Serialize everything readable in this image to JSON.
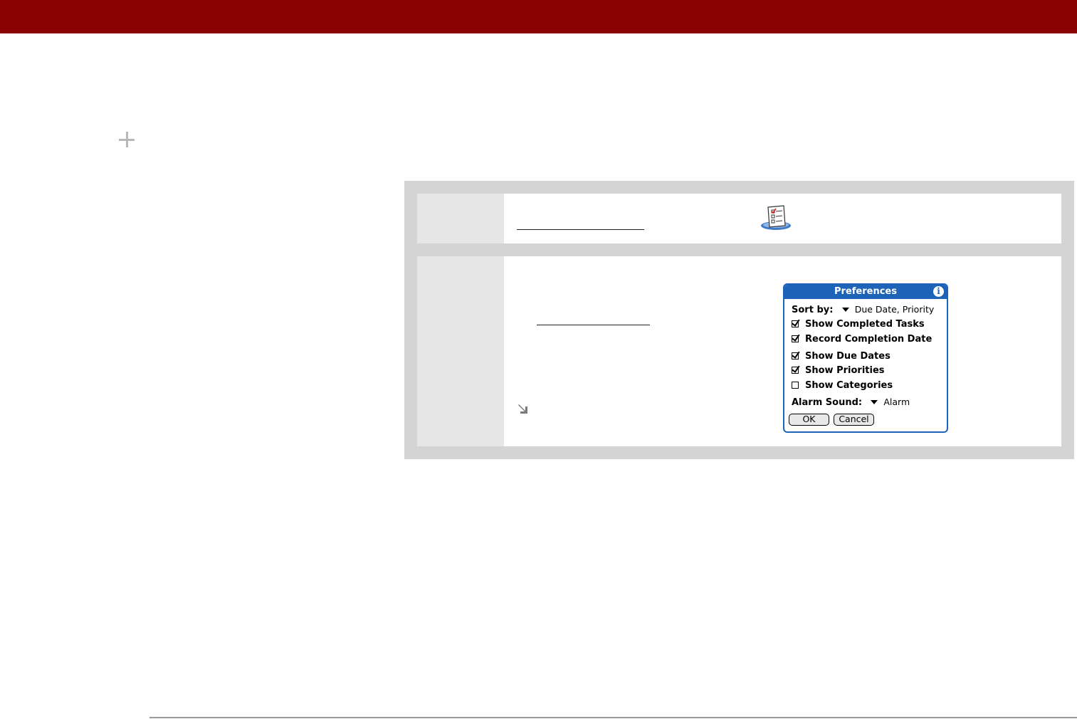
{
  "colors": {
    "top_bar": "#8b0000",
    "panel": "#d4d4d4",
    "step_number_cell": "#e6e6e6",
    "palm_accent": "#1d64b8"
  },
  "icons": {
    "plus": "plus-icon",
    "tasks_app": "tasks-app-icon",
    "arrow": "arrow-down-right-icon",
    "info": "info-icon"
  },
  "dialog": {
    "title": "Preferences",
    "info_glyph": "i",
    "sort_label": "Sort by:",
    "sort_value": "Due Date, Priority",
    "checkboxes": [
      {
        "label": "Show Completed Tasks",
        "checked": true
      },
      {
        "label": "Record Completion Date",
        "checked": true
      },
      {
        "label": "Show Due Dates",
        "checked": true
      },
      {
        "label": "Show Priorities",
        "checked": true
      },
      {
        "label": "Show Categories",
        "checked": false
      }
    ],
    "alarm_label": "Alarm Sound:",
    "alarm_value": "Alarm",
    "ok_label": "OK",
    "cancel_label": "Cancel"
  }
}
